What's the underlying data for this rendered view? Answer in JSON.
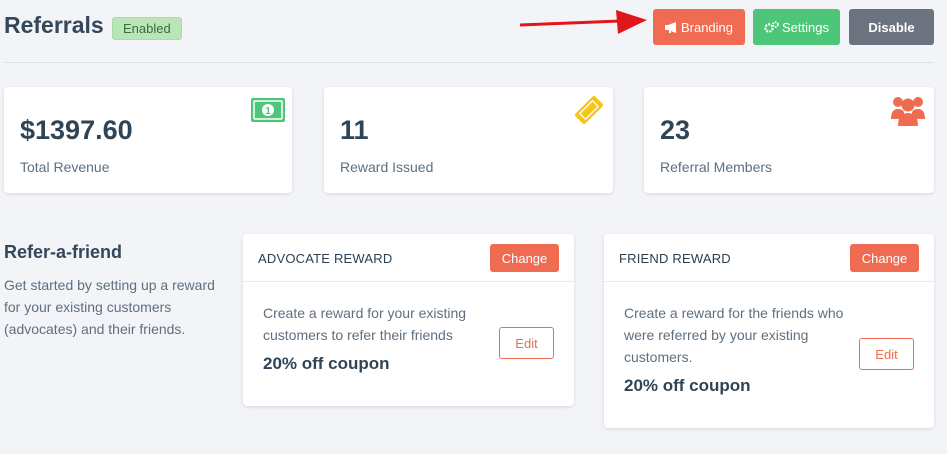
{
  "header": {
    "title": "Referrals",
    "status_badge": "Enabled",
    "buttons": {
      "branding": "Branding",
      "settings": "Settings",
      "disable": "Disable"
    }
  },
  "stats": [
    {
      "value": "$1397.60",
      "label": "Total Revenue",
      "icon": "money-bill-icon"
    },
    {
      "value": "11",
      "label": "Reward Issued",
      "icon": "ticket-icon"
    },
    {
      "value": "23",
      "label": "Referral Members",
      "icon": "users-icon"
    }
  ],
  "refer_a_friend": {
    "title": "Refer-a-friend",
    "description": "Get started by setting up a reward for your existing customers (advocates) and their friends."
  },
  "rewards": {
    "advocate": {
      "title": "ADVOCATE REWARD",
      "change_label": "Change",
      "description": "Create a reward for your existing customers to refer their friends",
      "value": "20% off coupon",
      "edit_label": "Edit"
    },
    "friend": {
      "title": "FRIEND REWARD",
      "change_label": "Change",
      "description": "Create a reward for the friends who were referred by your existing customers.",
      "value": "20% off coupon",
      "edit_label": "Edit"
    }
  },
  "colors": {
    "accent": "#ef6c52",
    "success": "#4dc67a",
    "neutral": "#6b7280",
    "badge": "#b8e6b8",
    "arrow": "#e0161b",
    "ticket": "#f5c518"
  }
}
